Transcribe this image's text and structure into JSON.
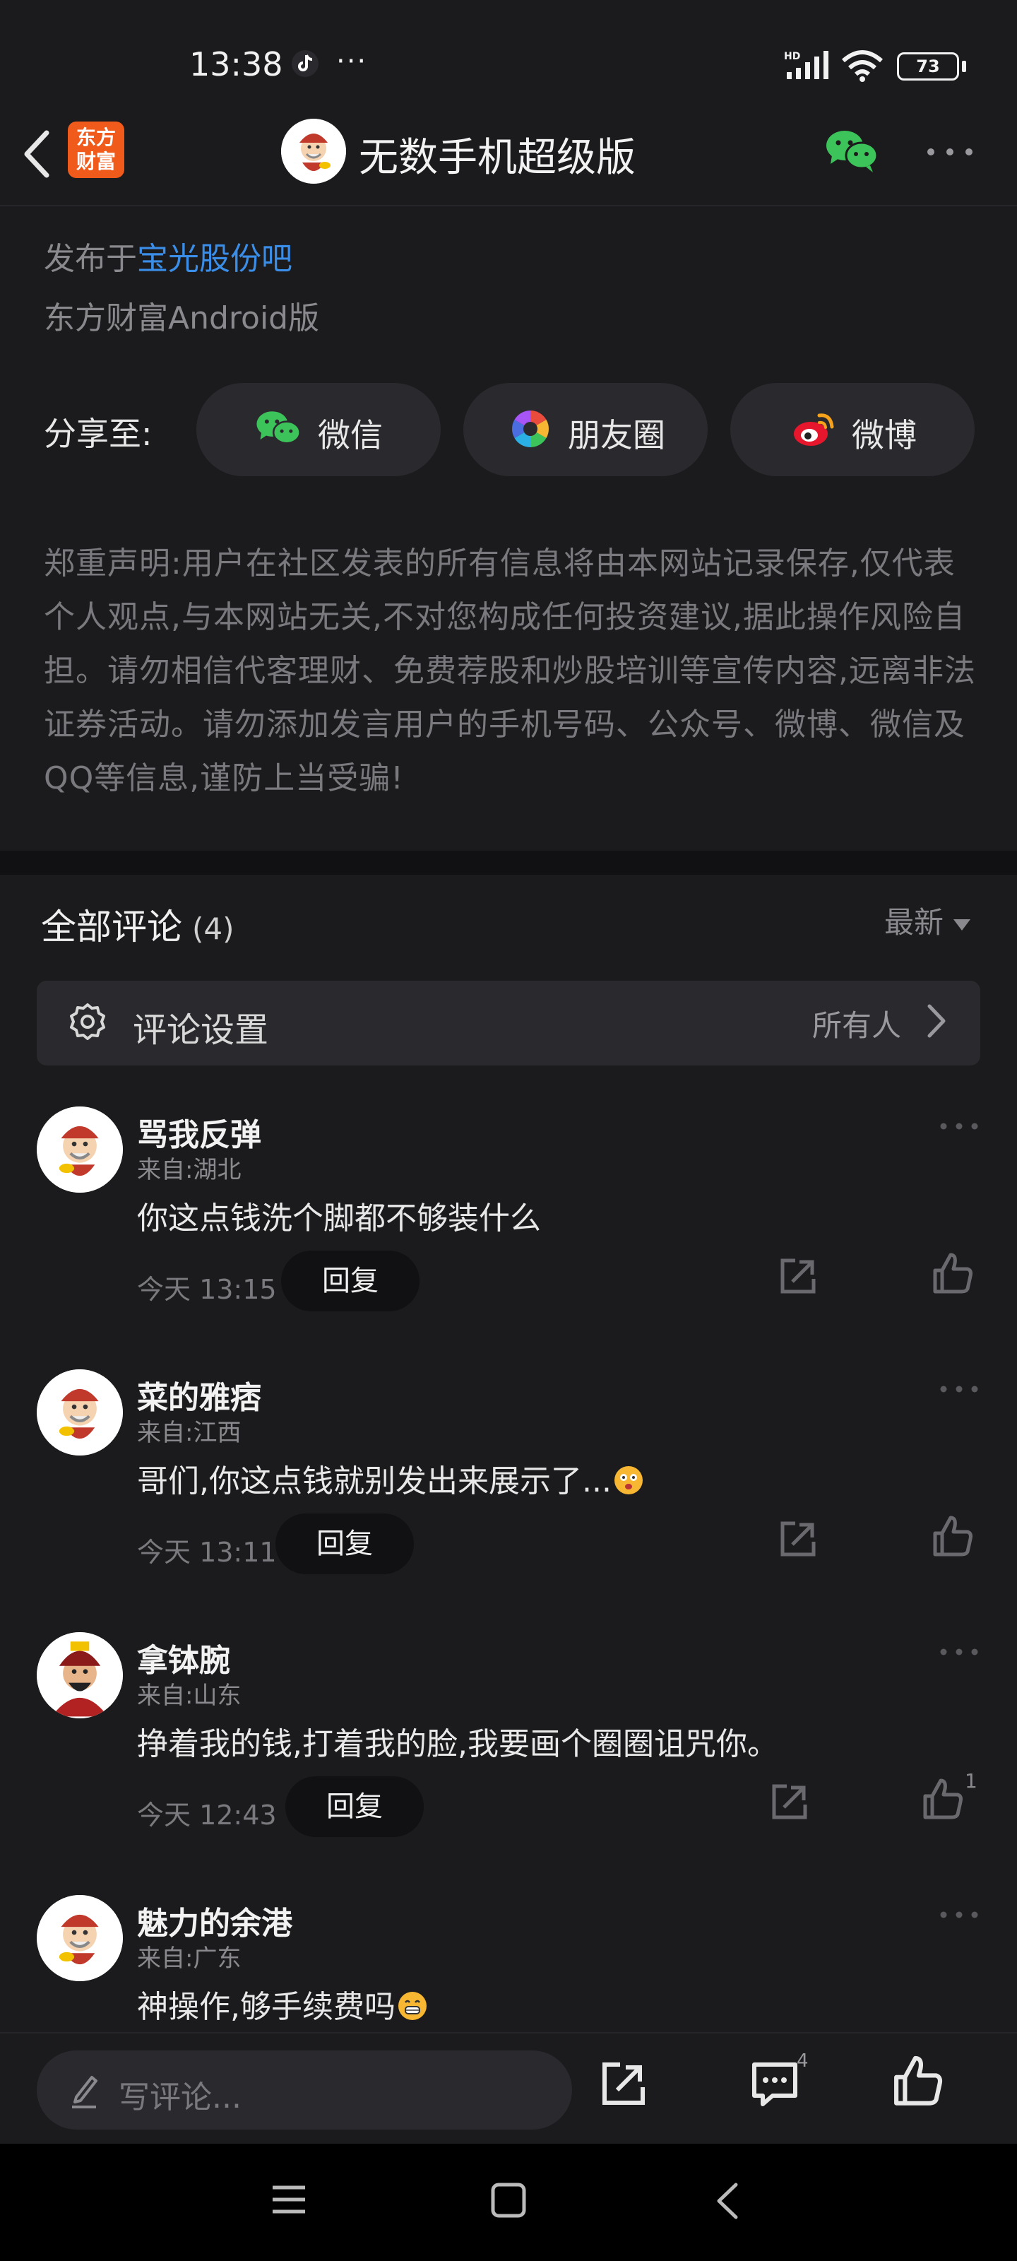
{
  "status_bar": {
    "time": "13:38",
    "dots": "···",
    "battery": "73"
  },
  "header": {
    "brand_logo": "东方\n财富",
    "brand_logo_line1": "东方",
    "brand_logo_line2": "财富",
    "title": "无数手机超级版"
  },
  "post": {
    "published_prefix": "发布于",
    "published_bar": "宝光股份吧",
    "client": "东方财富Android版"
  },
  "share": {
    "label": "分享至:",
    "buttons": [
      {
        "label": "微信",
        "icon": "wechat-icon"
      },
      {
        "label": "朋友圈",
        "icon": "moments-icon"
      },
      {
        "label": "微博",
        "icon": "weibo-icon"
      }
    ]
  },
  "disclaimer": "郑重声明:用户在社区发表的所有信息将由本网站记录保存,仅代表个人观点,与本网站无关,不对您构成任何投资建议,据此操作风险自担。请勿相信代客理财、免费荐股和炒股培训等宣传内容,远离非法证券活动。请勿添加发言用户的手机号码、公众号、微博、微信及QQ等信息,谨防上当受骗!",
  "comments_section": {
    "title": "全部评论",
    "count": "(4)",
    "sort": "最新",
    "settings_label": "评论设置",
    "settings_value": "所有人"
  },
  "comments": [
    {
      "name": "骂我反弹",
      "location": "来自:湖北",
      "text": "你这点钱洗个脚都不够装什么",
      "time": "今天 13:15",
      "reply": "回复",
      "likes": ""
    },
    {
      "name": "菜的雅痞",
      "location": "来自:江西",
      "text": "哥们,你这点钱就别发出来展示了...",
      "time": "今天 13:11",
      "reply": "回复",
      "likes": ""
    },
    {
      "name": "拿钵腕",
      "location": "来自:山东",
      "text": "挣着我的钱,打着我的脸,我要画个圈圈诅咒你。",
      "time": "今天 12:43",
      "reply": "回复",
      "likes": "1"
    },
    {
      "name": "魅力的余港",
      "location": "来自:广东",
      "text": "神操作,够手续费吗",
      "time": "",
      "reply": "",
      "likes": ""
    }
  ],
  "action_bar": {
    "placeholder": "写评论...",
    "comment_badge": "4"
  },
  "colors": {
    "background": "#1b1b1d",
    "link": "#3b8ee8",
    "brand": "#f05a1a",
    "wechat": "#3cc45a"
  }
}
